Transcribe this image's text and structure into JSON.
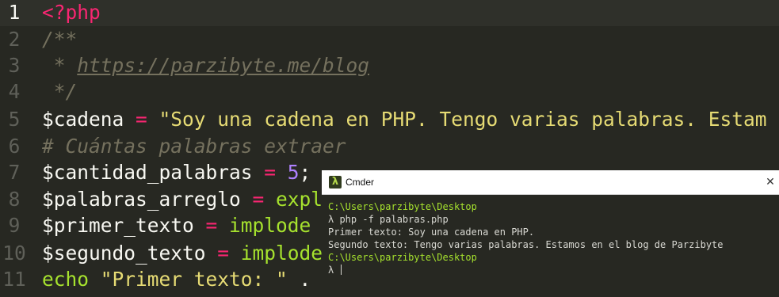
{
  "editor": {
    "lines": [
      {
        "num": "1",
        "parts": [
          {
            "t": "php",
            "v": "<?php"
          }
        ]
      },
      {
        "num": "2",
        "parts": [
          {
            "t": "comment",
            "v": "/**"
          }
        ]
      },
      {
        "num": "3",
        "parts": [
          {
            "t": "comment",
            "v": " * "
          },
          {
            "t": "comment link",
            "v": "https://parzibyte.me/blog"
          }
        ]
      },
      {
        "num": "4",
        "parts": [
          {
            "t": "comment",
            "v": " */"
          }
        ]
      },
      {
        "num": "5",
        "parts": [
          {
            "t": "var",
            "v": "$cadena"
          },
          {
            "t": "op",
            "v": " = "
          },
          {
            "t": "str",
            "v": "\"Soy una cadena en PHP. Tengo varias palabras. Estam"
          }
        ]
      },
      {
        "num": "6",
        "parts": [
          {
            "t": "comment",
            "v": "# Cuántas palabras extraer"
          }
        ]
      },
      {
        "num": "7",
        "parts": [
          {
            "t": "var",
            "v": "$cantidad_palabras"
          },
          {
            "t": "op",
            "v": " = "
          },
          {
            "t": "num",
            "v": "5"
          },
          {
            "t": "plain",
            "v": ";"
          }
        ]
      },
      {
        "num": "8",
        "parts": [
          {
            "t": "var",
            "v": "$palabras_arreglo"
          },
          {
            "t": "op",
            "v": " = "
          },
          {
            "t": "fn",
            "v": "expl"
          }
        ]
      },
      {
        "num": "9",
        "parts": [
          {
            "t": "var",
            "v": "$primer_texto"
          },
          {
            "t": "op",
            "v": " = "
          },
          {
            "t": "fn",
            "v": "implode"
          }
        ]
      },
      {
        "num": "10",
        "parts": [
          {
            "t": "var",
            "v": "$segundo_texto"
          },
          {
            "t": "op",
            "v": " = "
          },
          {
            "t": "fn",
            "v": "implode"
          }
        ]
      },
      {
        "num": "11",
        "parts": [
          {
            "t": "kw",
            "v": "echo"
          },
          {
            "t": "plain",
            "v": " "
          },
          {
            "t": "str",
            "v": "\"Primer texto: \""
          },
          {
            "t": "plain",
            "v": " ."
          }
        ]
      }
    ]
  },
  "terminal": {
    "app_icon": "lambda-icon",
    "app_icon_glyph": "λ",
    "title": "Cmder",
    "close_glyph": "✕",
    "lines": [
      {
        "kind": "path",
        "text": "C:\\Users\\parzibyte\\Desktop"
      },
      {
        "kind": "cmd",
        "text": "λ php -f palabras.php"
      },
      {
        "kind": "out",
        "text": "Primer texto: Soy una cadena en PHP."
      },
      {
        "kind": "out",
        "text": "Segundo texto: Tengo varias palabras. Estamos en el blog de Parzibyte"
      },
      {
        "kind": "path",
        "text": "C:\\Users\\parzibyte\\Desktop"
      },
      {
        "kind": "prompt",
        "text": "λ "
      }
    ]
  }
}
